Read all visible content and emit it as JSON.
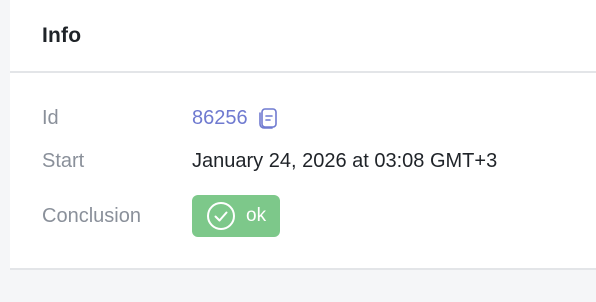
{
  "card": {
    "title": "Info"
  },
  "fields": {
    "id_label": "Id",
    "id_value": "86256",
    "start_label": "Start",
    "start_value": "January 24, 2026 at 03:08 GMT+3",
    "conclusion_label": "Conclusion",
    "conclusion_value": "ok"
  },
  "icons": {
    "copy": "copy-icon",
    "status": "check-circle-icon"
  },
  "colors": {
    "link": "#6f7ad0",
    "badge_bg": "#7dc88a",
    "label": "#8a909a",
    "text": "#1f2328"
  }
}
